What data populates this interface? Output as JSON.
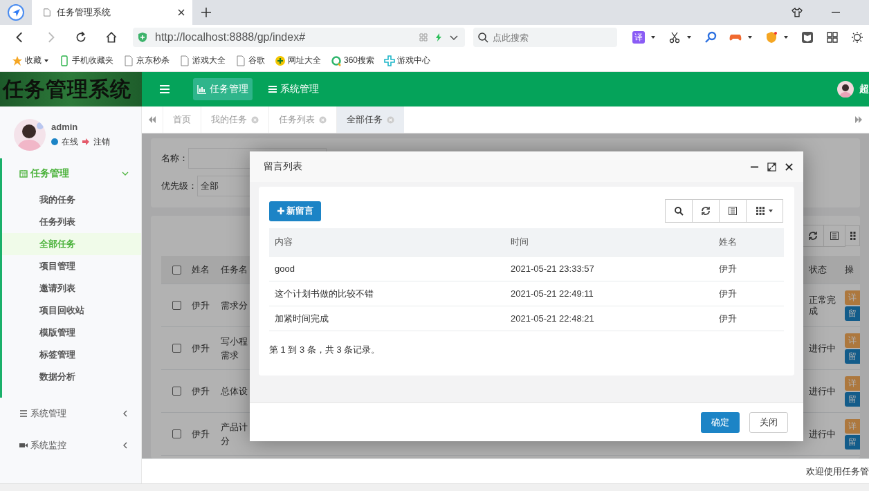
{
  "browser": {
    "tab_title": "任务管理系统",
    "url": "http://localhost:8888/gp/index#",
    "search_placeholder": "点此搜索",
    "translate_label": "译",
    "bookmarks": [
      {
        "label": "收藏",
        "kind": "star"
      },
      {
        "label": "手机收藏夹",
        "kind": "phone"
      },
      {
        "label": "京东秒杀",
        "kind": "page"
      },
      {
        "label": "游戏大全",
        "kind": "page"
      },
      {
        "label": "谷歌",
        "kind": "page"
      },
      {
        "label": "网址大全",
        "kind": "plus"
      },
      {
        "label": "360搜索",
        "kind": "ring"
      },
      {
        "label": "游戏中心",
        "kind": "cross"
      }
    ]
  },
  "header": {
    "logo": "任务管理系统",
    "user_name": "超",
    "nav": [
      {
        "label": "任务管理",
        "kind": "chart",
        "selected": true
      },
      {
        "label": "系统管理",
        "kind": "list",
        "selected": false
      }
    ]
  },
  "sidebar": {
    "user": "admin",
    "status": "在线",
    "logout": "注销",
    "menu": [
      {
        "label": "任务管理",
        "kind": "calendar",
        "expanded": true,
        "children": [
          {
            "label": "我的任务",
            "selected": false
          },
          {
            "label": "任务列表",
            "selected": false
          },
          {
            "label": "全部任务",
            "selected": true
          },
          {
            "label": "项目管理",
            "selected": false
          },
          {
            "label": "邀请列表",
            "selected": false
          },
          {
            "label": "项目回收站",
            "selected": false
          },
          {
            "label": "模版管理",
            "selected": false
          },
          {
            "label": "标签管理",
            "selected": false
          },
          {
            "label": "数据分析",
            "selected": false
          }
        ]
      },
      {
        "label": "系统管理",
        "kind": "list",
        "expanded": false
      },
      {
        "label": "系统监控",
        "kind": "camera",
        "expanded": false
      }
    ]
  },
  "page_tabs": [
    {
      "label": "首页",
      "closable": false,
      "selected": false
    },
    {
      "label": "我的任务",
      "closable": true,
      "selected": false
    },
    {
      "label": "任务列表",
      "closable": true,
      "selected": false
    },
    {
      "label": "全部任务",
      "closable": true,
      "selected": true
    }
  ],
  "search_form": {
    "name_label": "名称：",
    "priority_label": "优先级：",
    "priority_value": "全部"
  },
  "task_table": {
    "columns": [
      "姓名",
      "任务名",
      "状态",
      "操"
    ],
    "all_checked": false,
    "rows": [
      {
        "checked": false,
        "name": "伊升",
        "task": [
          "需求分"
        ],
        "status": "正常完成",
        "actions": [
          "详",
          "留"
        ]
      },
      {
        "checked": false,
        "name": "伊升",
        "task": [
          "写小程",
          "需求"
        ],
        "status": "进行中",
        "actions": [
          "详",
          "留"
        ]
      },
      {
        "checked": false,
        "name": "伊升",
        "task": [
          "总体设"
        ],
        "status": "进行中",
        "actions": [
          "详",
          "留"
        ]
      },
      {
        "checked": false,
        "name": "伊升",
        "task": [
          "产品计",
          "分"
        ],
        "status": "进行中",
        "actions": [
          "详",
          "留"
        ]
      }
    ]
  },
  "dialog": {
    "title": "留言列表",
    "add_button": "新留言",
    "columns": [
      "内容",
      "时间",
      "姓名"
    ],
    "rows": [
      {
        "content": "good",
        "time": "2021-05-21 23:33:57",
        "name": "伊升"
      },
      {
        "content": "这个计划书做的比较不错",
        "time": "2021-05-21 22:49:11",
        "name": "伊升"
      },
      {
        "content": "加紧时间完成",
        "time": "2021-05-21 22:48:21",
        "name": "伊升"
      }
    ],
    "summary": "第 1 到 3 条，共 3 条记录。",
    "confirm": "确定",
    "close": "关闭"
  },
  "footer": "欢迎使用任务管"
}
